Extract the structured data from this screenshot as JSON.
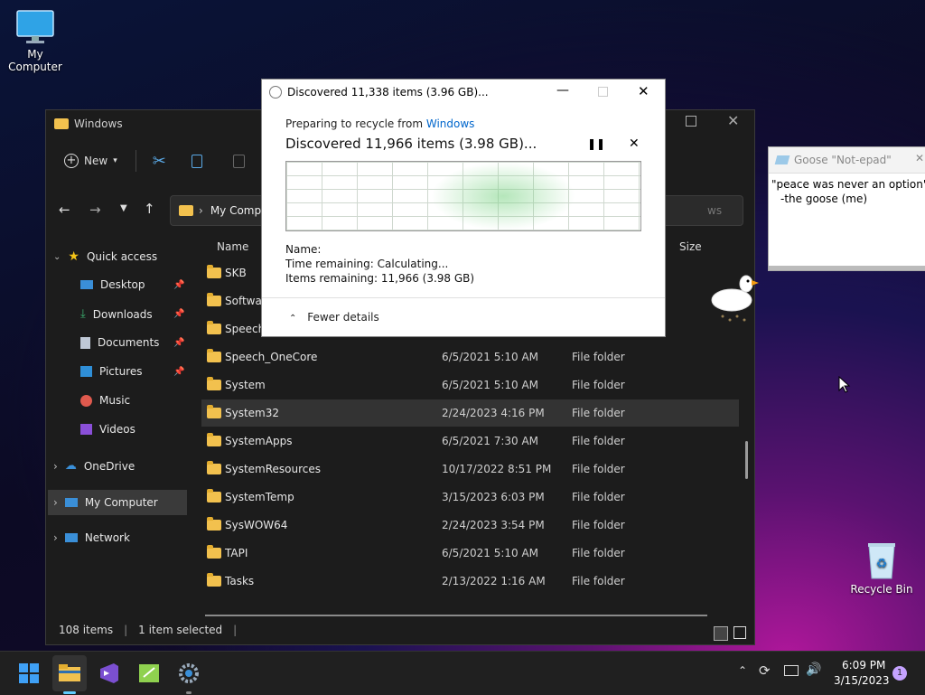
{
  "desktop": {
    "my_computer_label": "My Computer",
    "recycle_bin_label": "Recycle Bin"
  },
  "explorer": {
    "title": "Windows",
    "toolbar": {
      "new_label": "New"
    },
    "address": {
      "root": "My Compu",
      "search_placeholder": "ws"
    },
    "nav": {
      "quick_access": "Quick access",
      "items": [
        "Desktop",
        "Downloads",
        "Documents",
        "Pictures",
        "Music",
        "Videos"
      ],
      "onedrive": "OneDrive",
      "my_computer": "My Computer",
      "network": "Network"
    },
    "columns": {
      "name": "Name",
      "size": "Size"
    },
    "rows": [
      {
        "name": "SKB",
        "date": "",
        "type": ""
      },
      {
        "name": "Softwar",
        "date": "",
        "type": ""
      },
      {
        "name": "Speech",
        "date": "",
        "type": ""
      },
      {
        "name": "Speech_OneCore",
        "date": "6/5/2021 5:10 AM",
        "type": "File folder"
      },
      {
        "name": "System",
        "date": "6/5/2021 5:10 AM",
        "type": "File folder"
      },
      {
        "name": "System32",
        "date": "2/24/2023 4:16 PM",
        "type": "File folder"
      },
      {
        "name": "SystemApps",
        "date": "6/5/2021 7:30 AM",
        "type": "File folder"
      },
      {
        "name": "SystemResources",
        "date": "10/17/2022 8:51 PM",
        "type": "File folder"
      },
      {
        "name": "SystemTemp",
        "date": "3/15/2023 6:03 PM",
        "type": "File folder"
      },
      {
        "name": "SysWOW64",
        "date": "2/24/2023 3:54 PM",
        "type": "File folder"
      },
      {
        "name": "TAPI",
        "date": "6/5/2021 5:10 AM",
        "type": "File folder"
      },
      {
        "name": "Tasks",
        "date": "2/13/2022 1:16 AM",
        "type": "File folder"
      }
    ],
    "status": {
      "count": "108 items",
      "selected": "1 item selected"
    }
  },
  "dialog": {
    "title": "Discovered 11,338 items (3.96 GB)...",
    "preparing": "Preparing to recycle from",
    "preparing_link": "Windows",
    "heading": "Discovered 11,966 items (3.98 GB)...",
    "name_label": "Name:",
    "time_label": "Time remaining:",
    "time_value": "Calculating...",
    "items_label": "Items remaining:",
    "items_value": "11,966 (3.98 GB)",
    "fewer_details": "Fewer details"
  },
  "notepad": {
    "title": "Goose \"Not-epad\"",
    "line1": "\"peace was never an option\"",
    "line2": "-the goose (me)"
  },
  "taskbar": {
    "time": "6:09 PM",
    "date": "3/15/2023",
    "notification_count": "1"
  },
  "colors": {
    "accent": "#0067c0",
    "folder": "#f2c14e",
    "link": "#0066cc"
  }
}
